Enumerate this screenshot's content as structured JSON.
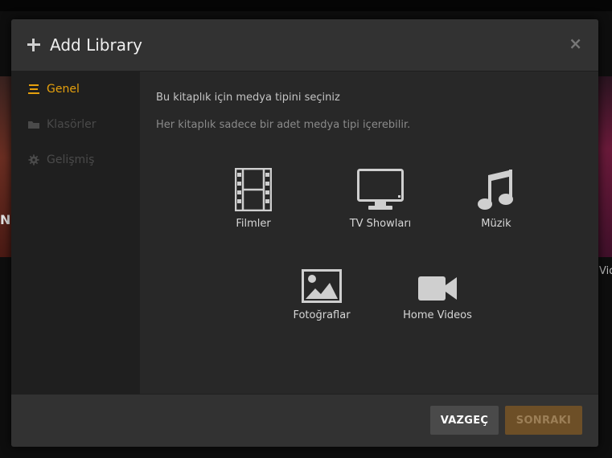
{
  "dialog": {
    "title": "Add Library",
    "close_symbol": "×"
  },
  "background": {
    "left_poster_text": "N",
    "right_caption": "Vid"
  },
  "sidebar": {
    "items": [
      {
        "label": "Genel",
        "icon": "list-icon",
        "state": "active"
      },
      {
        "label": "Klasörler",
        "icon": "folder-icon",
        "state": "disabled"
      },
      {
        "label": "Gelişmiş",
        "icon": "gear-icon",
        "state": "disabled"
      }
    ]
  },
  "content": {
    "lead": "Bu kitaplık için medya tipini seçiniz",
    "sub": "Her kitaplık sadece bir adet medya tipi içerebilir.",
    "media_types": [
      {
        "label": "Filmler",
        "icon": "film-icon"
      },
      {
        "label": "TV Showları",
        "icon": "tv-icon"
      },
      {
        "label": "Müzik",
        "icon": "music-icon"
      },
      {
        "label": "Fotoğraflar",
        "icon": "photo-icon"
      },
      {
        "label": "Home Videos",
        "icon": "video-camera-icon"
      }
    ]
  },
  "footer": {
    "cancel_label": "VAZGEÇ",
    "next_label": "SONRAKI"
  },
  "colors": {
    "accent": "#e5a00d",
    "modal_bg": "#282828",
    "header_bg": "#323232",
    "sidebar_bg": "#1f1f1f",
    "cancel_bg": "#4a4a4a",
    "next_bg": "#6d4f27"
  }
}
